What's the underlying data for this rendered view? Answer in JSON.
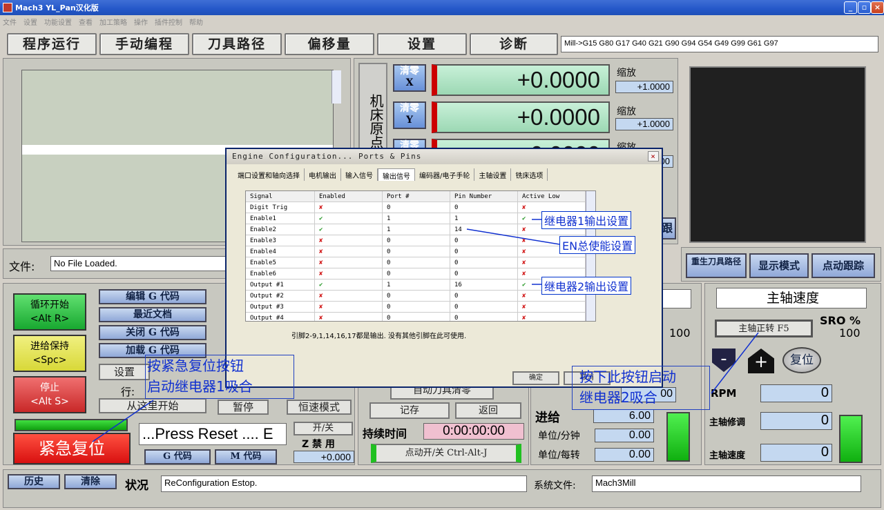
{
  "window": {
    "title": "Mach3  YL_Pan汉化版",
    "min": "_",
    "max": "▫",
    "close": "×"
  },
  "menu": [
    "文件",
    "设置",
    "功能设置",
    "查看",
    "加工策略",
    "操作",
    "插件控制",
    "帮助"
  ],
  "tabs": [
    "程序运行",
    "手动编程",
    "刀具路径",
    "偏移量",
    "设置",
    "诊断"
  ],
  "gcode_state": "Mill->G15  G80 G17 G40 G21 G90 G94 G54 G49 G99 G61 G97",
  "machine_coords_label": "机床原点",
  "dro": [
    {
      "zero": "清零",
      "axis": "X",
      "value": "+0.0000",
      "scale_label": "缩放",
      "scale": "+1.0000"
    },
    {
      "zero": "清零",
      "axis": "Y",
      "value": "+0.0000",
      "scale_label": "缩放",
      "scale": "+1.0000"
    },
    {
      "zero": "清零",
      "axis": "Z",
      "value": "+0.0000",
      "scale_label": "缩放",
      "scale": ".0000"
    }
  ],
  "file": {
    "label": "文件:",
    "value": "No File Loaded."
  },
  "left_buttons": {
    "cycle_start": "循环开始",
    "cycle_start_key": "<Alt R>",
    "feed_hold": "进给保持",
    "feed_hold_key": "<Spc>",
    "stop": "停止",
    "stop_key": "<Alt S>",
    "reset": "紧急复位"
  },
  "file_buttons": [
    "编辑 G 代码",
    "最近文档",
    "关闭 G 代码",
    "加载 G 代码"
  ],
  "settings_btn": "设置",
  "line_label": "行:",
  "run_from_here": "从这里开始",
  "pause": "暂停",
  "const_mode": "恒速模式",
  "on_off": "开/关",
  "z_inhibit": "Z 禁 用",
  "z_value": "+0.000",
  "reset_msg": "...Press Reset .... E",
  "gcode_btn": "G 代码",
  "mcode_btn": "M 代码",
  "right_top_buttons": [
    "重生刀具路径",
    "显示模式",
    "点动跟踪"
  ],
  "follow_btn": "跟",
  "spindle": {
    "title": "主轴速度",
    "cw": "主轴正转 F5",
    "sro": "SRO %",
    "sro_val": "100",
    "reset": "复位",
    "minus": "-",
    "plus": "+",
    "rpm_label": "RPM",
    "rpm": "0",
    "override_label": "主轴修调",
    "override": "0",
    "speed_label": "主轴速度",
    "speed": "0"
  },
  "feed": {
    "pct": "100",
    "label": "进给",
    "value": "6.00",
    "per_min_label": "单位/分钟",
    "per_min": "0.00",
    "per_rev_label": "单位/每转",
    "per_rev": "0.00",
    "f_display": "00"
  },
  "mid_controls": {
    "auto_zero": "自动刀具清零",
    "remember": "记存",
    "return": "返回",
    "elapsed_label": "持续时间",
    "elapsed": "0:00:00:00",
    "jog": "点动开/关 Ctrl-Alt-J"
  },
  "bottom": {
    "history": "历史",
    "clear": "清除",
    "status_label": "状况",
    "status": "ReConfiguration Estop.",
    "profile_label": "系统文件:",
    "profile": "Mach3Mill"
  },
  "dialog": {
    "title": "Engine Configuration... Ports & Pins",
    "close": "×",
    "tabs": [
      "端口设置和轴向选择",
      "电机输出",
      "输入信号",
      "输出信号",
      "编码器/电子手轮",
      "主轴设置",
      "铣床选项"
    ],
    "headers": [
      "Signal",
      "Enabled",
      "Port #",
      "Pin Number",
      "Active Low"
    ],
    "rows": [
      [
        "Digit  Trig",
        "no",
        "0",
        "0",
        "no"
      ],
      [
        "Enable1",
        "ok",
        "1",
        "1",
        "ok"
      ],
      [
        "Enable2",
        "ok",
        "1",
        "14",
        "no"
      ],
      [
        "Enable3",
        "no",
        "0",
        "0",
        "no"
      ],
      [
        "Enable4",
        "no",
        "0",
        "0",
        "no"
      ],
      [
        "Enable5",
        "no",
        "0",
        "0",
        "no"
      ],
      [
        "Enable6",
        "no",
        "0",
        "0",
        "no"
      ],
      [
        "Output #1",
        "ok",
        "1",
        "16",
        "ok"
      ],
      [
        "Output #2",
        "no",
        "0",
        "0",
        "no"
      ],
      [
        "Output #3",
        "no",
        "0",
        "0",
        "no"
      ],
      [
        "Output #4",
        "no",
        "0",
        "0",
        "no"
      ]
    ],
    "note": "引脚2-9,1,14,16,17都是输出. 没有其他引脚在此可使用.",
    "ok": "确定",
    "cancel": "取消"
  },
  "annotations": {
    "relay1": "继电器1输出设置",
    "en": "EN总使能设置",
    "relay2": "继电器2输出设置",
    "estop_note1": "按紧急复位按钮",
    "estop_note2": "启动继电器1吸合",
    "btn_note1": "按下此按钮启动",
    "btn_note2": "继电器2吸合"
  }
}
